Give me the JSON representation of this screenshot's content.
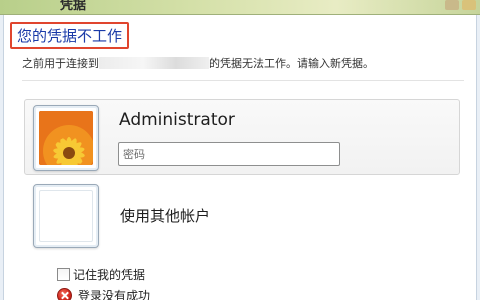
{
  "dialog": {
    "title_fragment": "凭据",
    "heading": "您的凭据不工作",
    "subtitle_prefix": "之前用于连接到",
    "subtitle_suffix": "的凭据无法工作。请输入新凭据。"
  },
  "accounts": {
    "admin": {
      "name": "Administrator",
      "password_placeholder": "密码",
      "tile_icon": "flower-user-picture"
    },
    "other": {
      "label": "使用其他帐户",
      "tile_icon": "blank-user-picture"
    }
  },
  "options": {
    "remember_label": "记住我的凭据",
    "remember_checked": false
  },
  "status": {
    "error_text": "登录没有成功",
    "error_icon": "error-icon"
  },
  "colors": {
    "heading": "#1a3aa8",
    "highlight_box": "#e0452e"
  }
}
